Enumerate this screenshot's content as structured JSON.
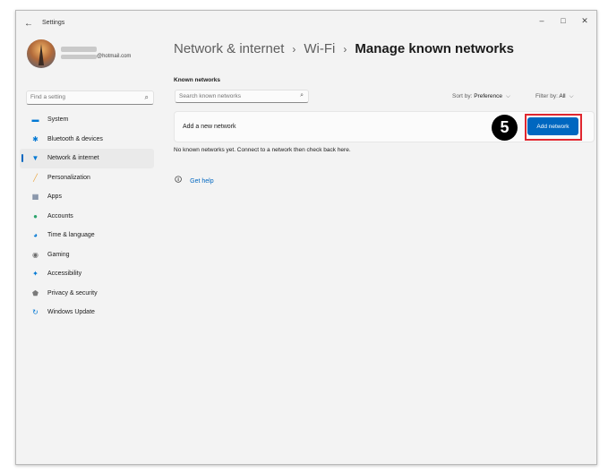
{
  "window": {
    "app_title": "Settings",
    "back_icon": "back-arrow-icon",
    "controls": {
      "minimize": "–",
      "maximize": "□",
      "close": "✕"
    }
  },
  "user": {
    "email_suffix": "@hotmail.com"
  },
  "sidebar": {
    "search_placeholder": "Find a setting",
    "items": [
      {
        "label": "System",
        "icon": "system-icon",
        "color": "#0078d4"
      },
      {
        "label": "Bluetooth & devices",
        "icon": "bluetooth-icon",
        "color": "#0078d4"
      },
      {
        "label": "Network & internet",
        "icon": "wifi-icon",
        "color": "#0078d4",
        "active": true
      },
      {
        "label": "Personalization",
        "icon": "brush-icon",
        "color": "#e8a33c"
      },
      {
        "label": "Apps",
        "icon": "apps-icon",
        "color": "#5a6d8a"
      },
      {
        "label": "Accounts",
        "icon": "person-icon",
        "color": "#2aa36b"
      },
      {
        "label": "Time & language",
        "icon": "globe-clock-icon",
        "color": "#0078d4"
      },
      {
        "label": "Gaming",
        "icon": "gamepad-icon",
        "color": "#6d6d6d"
      },
      {
        "label": "Accessibility",
        "icon": "accessibility-icon",
        "color": "#0078d4"
      },
      {
        "label": "Privacy & security",
        "icon": "shield-icon",
        "color": "#7a7a7a"
      },
      {
        "label": "Windows Update",
        "icon": "update-icon",
        "color": "#0078d4"
      }
    ]
  },
  "main": {
    "breadcrumb": [
      "Network & internet",
      "Wi-Fi",
      "Manage known networks"
    ],
    "breadcrumb_sep": "›",
    "section_title": "Known networks",
    "search_placeholder": "Search known networks",
    "sort_label": "Sort by:",
    "sort_value": "Preference",
    "filter_label": "Filter by:",
    "filter_value": "All",
    "add_network_label": "Add a new network",
    "add_network_button": "Add network",
    "step_number": "5",
    "empty_message": "No known networks yet. Connect to a network then check back here.",
    "help_label": "Get help"
  },
  "colors": {
    "accent": "#0067c0",
    "highlight": "#e0272f"
  }
}
